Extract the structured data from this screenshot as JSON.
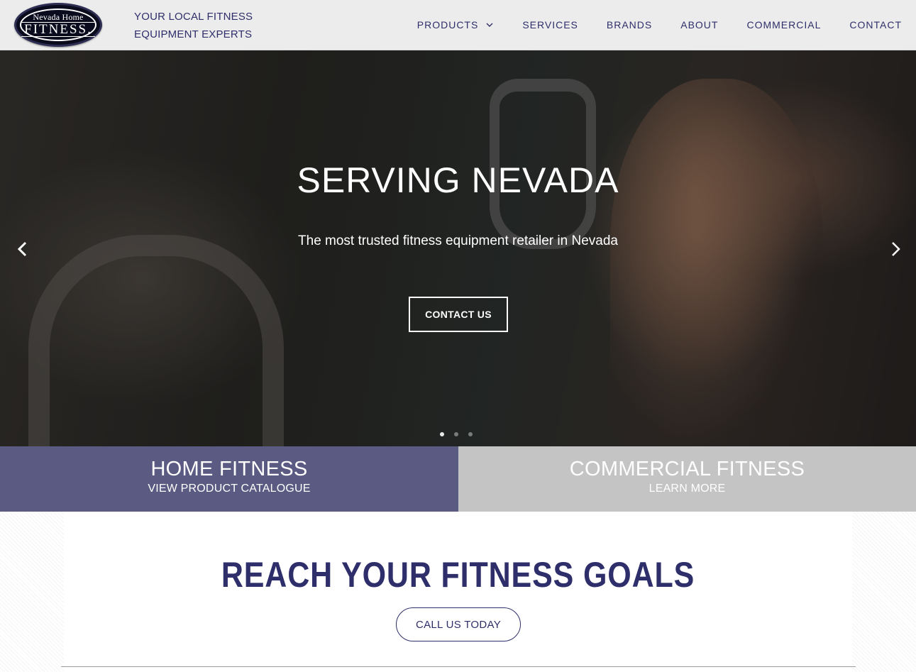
{
  "header": {
    "logo": {
      "line1": "Nevada Home",
      "line2": "FITNESS."
    },
    "tagline": {
      "line1": "YOUR LOCAL FITNESS",
      "line2": "EQUIPMENT EXPERTS"
    },
    "nav": [
      {
        "label": "PRODUCTS",
        "has_dropdown": true
      },
      {
        "label": "SERVICES"
      },
      {
        "label": "BRANDS"
      },
      {
        "label": "ABOUT"
      },
      {
        "label": "COMMERCIAL"
      },
      {
        "label": "CONTACT"
      }
    ]
  },
  "hero": {
    "title": "SERVING NEVADA",
    "subtitle": "The most trusted fitness equipment retailer in Nevada",
    "button": "CONTACT US",
    "slides": 3,
    "active_slide": 1
  },
  "blocks": {
    "home": {
      "title": "HOME FITNESS",
      "link": "VIEW PRODUCT CATALOGUE",
      "color": "#5b5a82"
    },
    "commercial": {
      "title": "COMMERCIAL FITNESS",
      "link": "LEARN MORE",
      "color": "#c4c4c4"
    }
  },
  "goals": {
    "title": "REACH YOUR FITNESS GOALS",
    "button": "CALL US TODAY"
  },
  "colors": {
    "brand_navy": "#2e2e6a",
    "header_bg": "#ececec"
  }
}
